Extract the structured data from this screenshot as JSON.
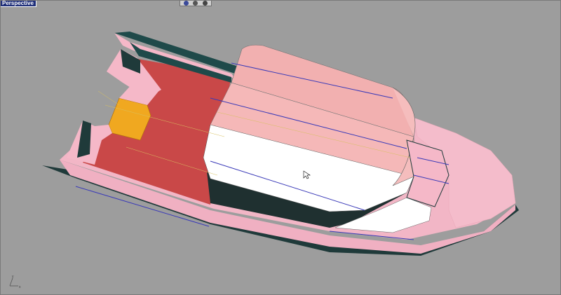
{
  "viewport": {
    "label": "Perspective",
    "background": "#9d9d9d"
  },
  "display_modes": [
    {
      "name": "shaded-mode-icon",
      "color": "#3a4a9a"
    },
    {
      "name": "rendered-mode-icon",
      "color": "#555555"
    },
    {
      "name": "ghosted-mode-icon",
      "color": "#444444"
    }
  ],
  "colors": {
    "hull_pink": "#f2b6c6",
    "deck_red": "#c94848",
    "cabin_pink": "#f5b8b8",
    "cabin_white": "#ffffff",
    "dark_teal": "#1f3a3a",
    "orange_seat": "#f0a820",
    "edge_blue": "#3a3ab8"
  },
  "gizmo": {
    "x_label": "x",
    "y_label": "y"
  }
}
